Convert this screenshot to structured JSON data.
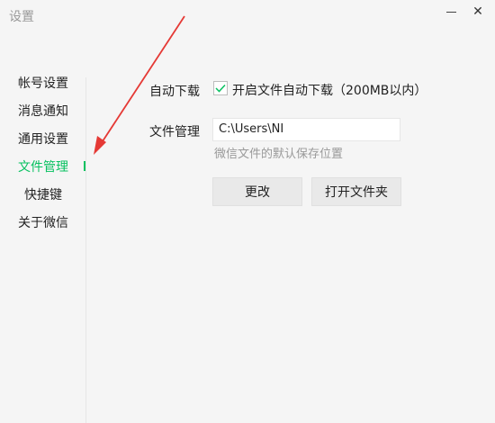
{
  "window": {
    "title": "设置",
    "minimize_icon": "minimize-icon",
    "close_icon": "close-icon",
    "close_glyph": "✕"
  },
  "sidebar": {
    "items": [
      {
        "label": "帐号设置",
        "active": false
      },
      {
        "label": "消息通知",
        "active": false
      },
      {
        "label": "通用设置",
        "active": false
      },
      {
        "label": "文件管理",
        "active": true
      },
      {
        "label": "快捷键",
        "active": false
      },
      {
        "label": "关于微信",
        "active": false
      }
    ]
  },
  "content": {
    "auto_download": {
      "label": "自动下载",
      "checkbox_text": "开启文件自动下载（200MB以内）",
      "checked": true
    },
    "file_management": {
      "label": "文件管理",
      "path_value": "C:\\Users\\NI",
      "hint": "微信文件的默认保存位置"
    },
    "buttons": {
      "change": "更改",
      "open_folder": "打开文件夹"
    }
  },
  "colors": {
    "accent": "#07c160",
    "annotation_arrow": "#e53935",
    "background": "#f5f5f5"
  }
}
